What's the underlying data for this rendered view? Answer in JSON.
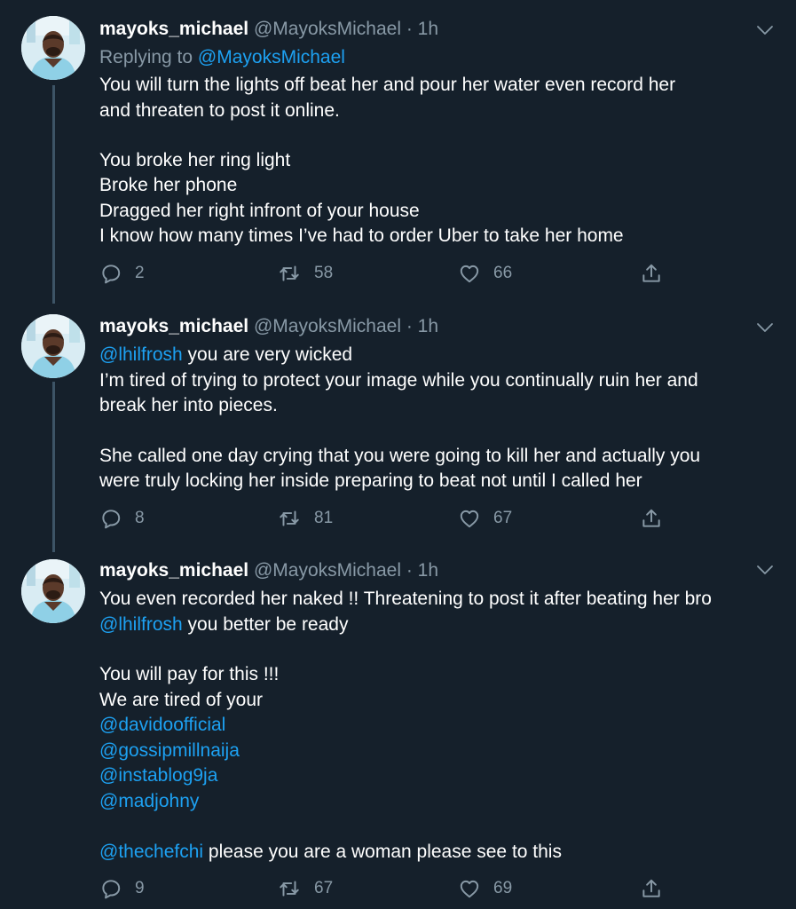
{
  "colors": {
    "background": "#15202b",
    "text": "#ffffff",
    "secondary": "#8899a6",
    "link": "#1da1f2"
  },
  "icons": {
    "reply": "reply-icon",
    "retweet": "retweet-icon",
    "like": "like-icon",
    "share": "share-icon",
    "caret": "chevron-down-icon"
  },
  "tweets": [
    {
      "name": "mayoks_michael",
      "handle": "@MayoksMichael",
      "sep": "·",
      "time": "1h",
      "replying_label": "Replying to",
      "replying_to": "@MayoksMichael",
      "lines": [
        "You will turn the lights off beat her and pour her water even record her",
        "and threaten to post it online.",
        "You broke her ring light",
        "Broke her phone",
        "Dragged her right infront of your house",
        "I know how many times I’ve had to order Uber to take her home"
      ],
      "replies": "2",
      "retweets": "58",
      "likes": "66"
    },
    {
      "name": "mayoks_michael",
      "handle": "@MayoksMichael",
      "sep": "·",
      "time": "1h",
      "mention_1": "@lhilfrosh",
      "line_1_rest": " you are very wicked",
      "lines": [
        "I’m tired of trying to protect your image while you continually ruin her and",
        "break her into pieces.",
        "She called one day crying that you were going to kill her and actually you",
        "were truly locking her inside preparing to beat not until I called her"
      ],
      "replies": "8",
      "retweets": "81",
      "likes": "67"
    },
    {
      "name": "mayoks_michael",
      "handle": "@MayoksMichael",
      "sep": "·",
      "time": "1h",
      "line_1": "You even recorded her naked !! Threatening to post it after beating her bro",
      "mention_1": "@lhilfrosh",
      "line_2_rest": " you better be ready",
      "lines": [
        "You will pay for this !!!",
        "We are tired of your"
      ],
      "mentions": [
        "@davidoofficial",
        "@gossipmillnaija",
        "@instablog9ja",
        "@madjohny"
      ],
      "last_mention": "@thechefchi",
      "last_rest": " please you are a woman please see to this",
      "replies": "9",
      "retweets": "67",
      "likes": "69"
    }
  ]
}
